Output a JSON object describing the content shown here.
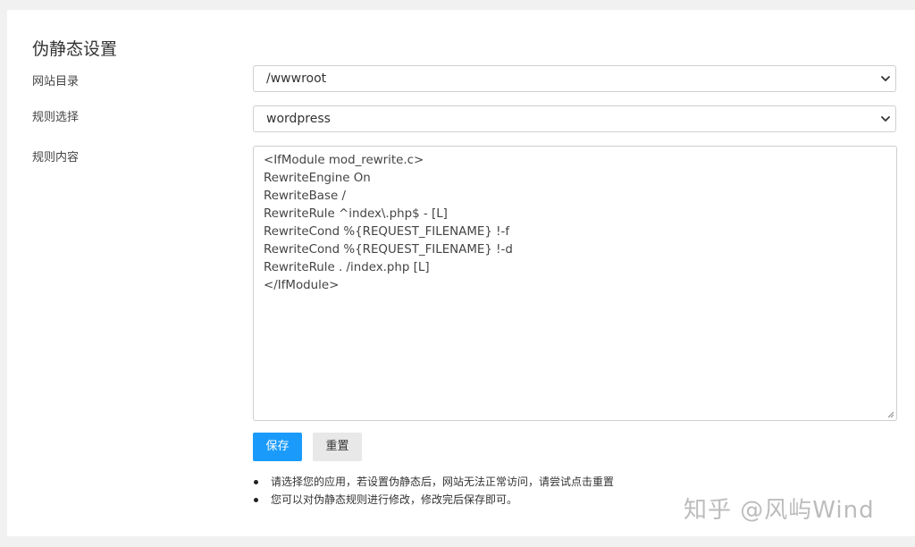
{
  "page": {
    "title": "伪静态设置"
  },
  "form": {
    "site_dir": {
      "label": "网站目录",
      "value": "/wwwroot"
    },
    "rule_select": {
      "label": "规则选择",
      "value": "wordpress"
    },
    "rule_content": {
      "label": "规则内容",
      "lines": [
        "<IfModule mod_rewrite.c>",
        "RewriteEngine On",
        "RewriteBase /",
        "RewriteRule ^index\\.php$ - [L]",
        "RewriteCond %{REQUEST_FILENAME} !-f",
        "RewriteCond %{REQUEST_FILENAME} !-d",
        "RewriteRule . /index.php [L]",
        "</IfModule>"
      ]
    }
  },
  "buttons": {
    "save_label": "保存",
    "reset_label": "重置"
  },
  "tips": [
    "请选择您的应用，若设置伪静态后，网站无法正常访问，请尝试点击重置",
    "您可以对伪静态规则进行修改，修改完后保存即可。"
  ],
  "watermark": "知乎 @风屿Wind",
  "colors": {
    "primary": "#1a9bfc",
    "secondary_button": "#e8e8e8",
    "border": "#cfcfcf",
    "background": "#f1f1f1"
  }
}
